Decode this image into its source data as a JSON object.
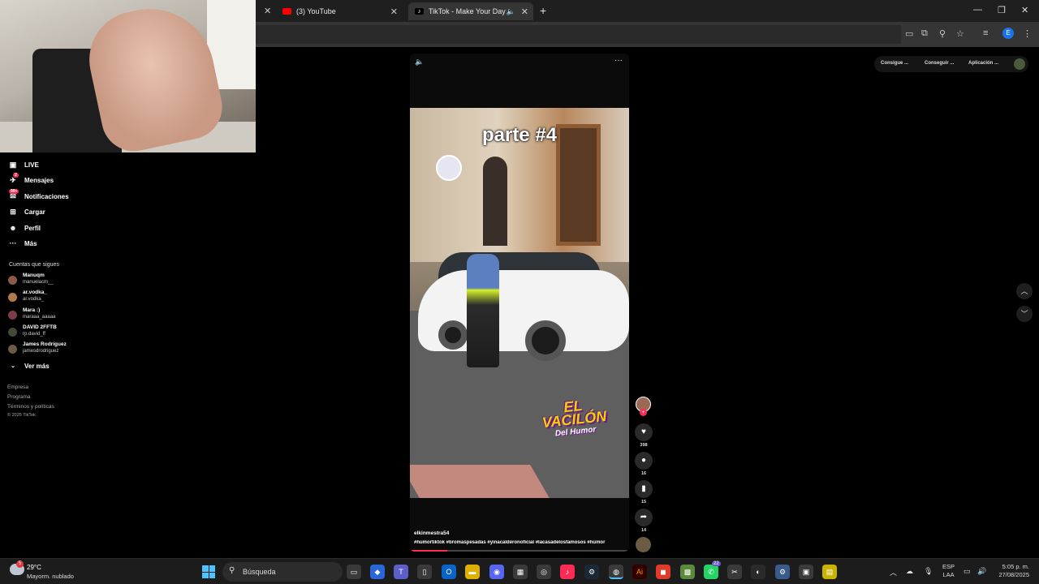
{
  "browser": {
    "tabs": [
      {
        "title": "(3) YouTube"
      },
      {
        "title": "TikTok - Make Your Day"
      }
    ],
    "new_tab": "+",
    "profile_initial": "E"
  },
  "sidebar": {
    "nav": [
      {
        "label": "LIVE",
        "icon": "live-icon"
      },
      {
        "label": "Mensajes",
        "icon": "messages-icon",
        "badge": "2"
      },
      {
        "label": "Notificaciones",
        "icon": "notifications-icon",
        "badge": "99+"
      },
      {
        "label": "Cargar",
        "icon": "upload-icon"
      },
      {
        "label": "Perfil",
        "icon": "profile-icon"
      },
      {
        "label": "Más",
        "icon": "more-icon"
      }
    ],
    "following_title": "Cuentas que sigues",
    "following": [
      {
        "name": "Manuqm",
        "handle": "manuelacm__"
      },
      {
        "name": "ar.vodka_",
        "handle": "ar.vodka_"
      },
      {
        "name": "Mara :)",
        "handle": "maraaa_aaaaa"
      },
      {
        "name": "DAVID 2FFTB",
        "handle": "rp.david_ff"
      },
      {
        "name": "James Rodríguez",
        "handle": "jamesdrodriguez"
      }
    ],
    "see_more": "Ver más",
    "footer": [
      "Empresa",
      "Programa",
      "Términos y políticas",
      "© 2025 TikTok"
    ]
  },
  "video": {
    "overlay_title": "parte #4",
    "brand_logo": "EL VACILÓN",
    "brand_logo_sub": "Del Humor",
    "author": "elkinmestra54",
    "hashtags": "#humortiktok #bromaspesadas #yinacalderonoficial #lacasadelosfamosos #humor",
    "progress": 0.17
  },
  "actions": {
    "likes": "398",
    "comments": "16",
    "saves": "15",
    "shares": "14"
  },
  "top_pills": [
    "Consigue ...",
    "Conseguir ...",
    "Aplicación ..."
  ],
  "taskbar": {
    "weather_temp": "29°C",
    "weather_desc": "Mayorm. nublado",
    "weather_badge": "5",
    "search_label": "Búsqueda",
    "lang_line1": "ESP",
    "lang_line2": "LAA",
    "time": "5:05 p. m.",
    "date": "27/08/2025",
    "whatsapp_badge": "22"
  },
  "colors": {
    "tiktok_pink": "#fe2c55",
    "youtube_red": "#ff0000",
    "start_blue": "#4cc2ff"
  }
}
